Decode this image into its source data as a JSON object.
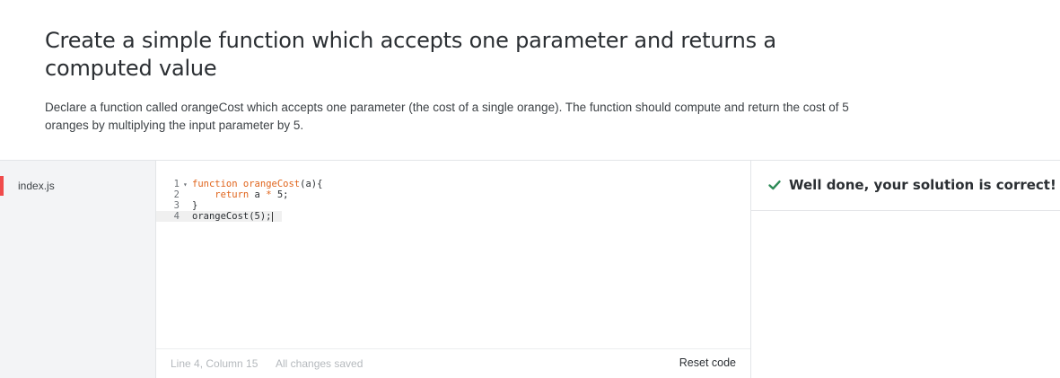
{
  "challenge": {
    "title": "Create a simple function which accepts one parameter and returns a computed value",
    "description": "Declare a function called orangeCost which accepts one parameter (the cost of a single orange). The function should compute and return the cost of 5 oranges by multiplying the input parameter by 5."
  },
  "files": {
    "items": [
      {
        "name": "index.js"
      }
    ]
  },
  "editor": {
    "line_numbers": [
      "1",
      "2",
      "3",
      "4"
    ],
    "fold_marker": "▾",
    "lines": {
      "l1": {
        "kw": "function",
        "fn": "orangeCost",
        "rest": "(a){"
      },
      "l2": {
        "indent": "    ",
        "kw": "return",
        "mid": " a ",
        "op": "*",
        "rest": " 5;"
      },
      "l3": {
        "rest": "}"
      },
      "l4": {
        "rest": "orangeCost(5);"
      }
    },
    "status": {
      "position": "Line 4, Column 15",
      "saved": "All changes saved"
    },
    "reset_label": "Reset code"
  },
  "result": {
    "message": "Well done, your solution is correct!",
    "check_color": "#2e8b57"
  },
  "colors": {
    "accent": "#f04b4b",
    "keyword": "#e0641b"
  }
}
